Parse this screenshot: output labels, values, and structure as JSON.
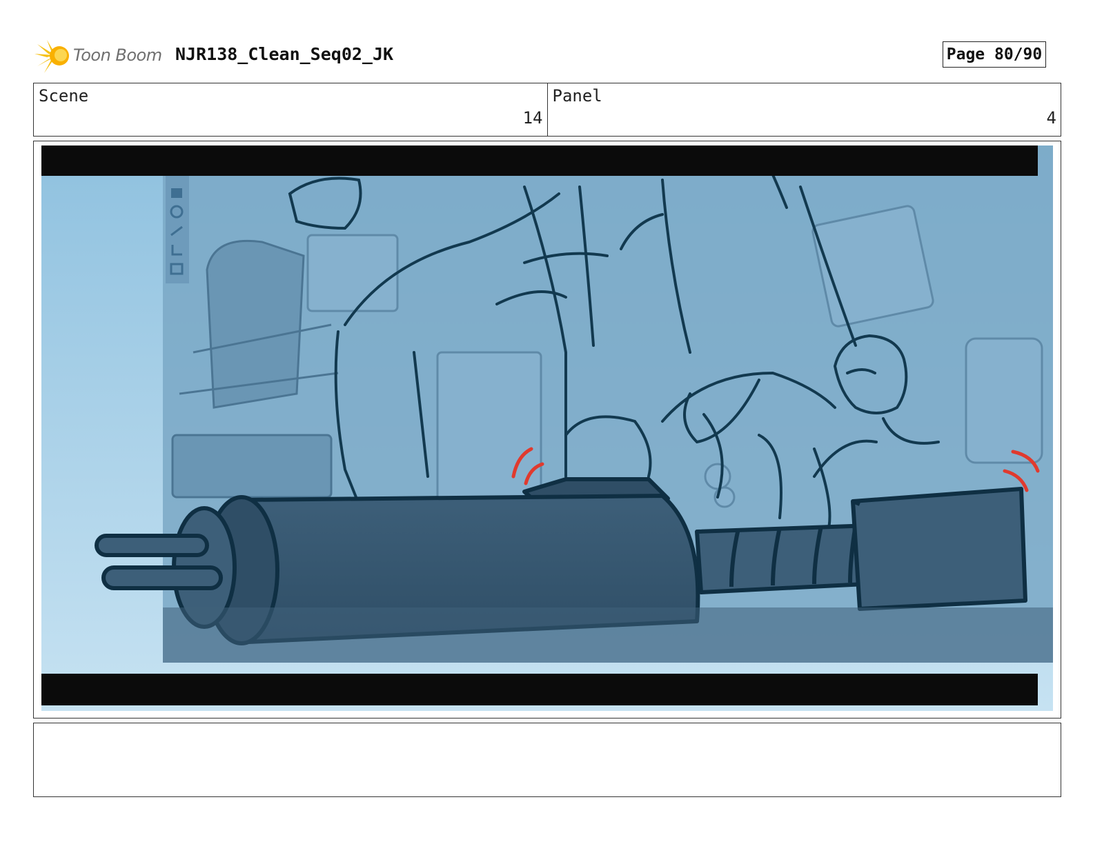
{
  "header": {
    "logo_text": "Toon Boom",
    "project_title": "NJR138_Clean_Seq02_JK",
    "page_label": "Page 80/90"
  },
  "info": {
    "scene_label": "Scene",
    "scene_value": "14",
    "panel_label": "Panel",
    "panel_value": "4"
  },
  "notes": {
    "text": ""
  },
  "colors": {
    "sky_top": "#8fc1df",
    "sky_bottom": "#c6e2f2",
    "ink": "#12394f",
    "letterbox": "#0b0b0b",
    "accent_red": "#e03a2e",
    "logo_yellow": "#f6c21b"
  }
}
